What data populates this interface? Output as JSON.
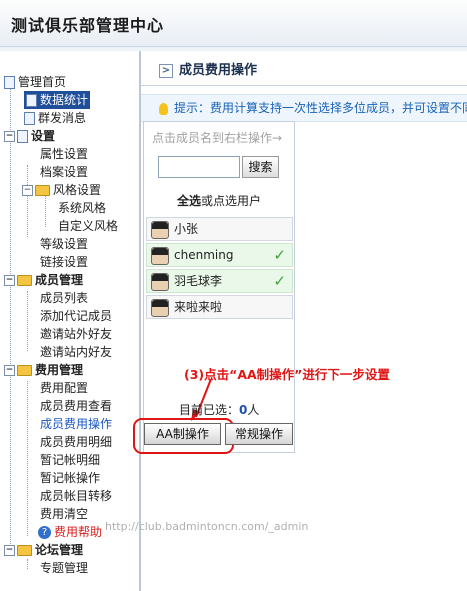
{
  "app": {
    "title": "测试俱乐部管理中心"
  },
  "sidebar": {
    "home": "管理首页",
    "stats": "数据统计",
    "messages": "群发消息",
    "settings": {
      "label": "设置",
      "items": {
        "attr": "属性设置",
        "profile": "档案设置",
        "style": "风格设置",
        "sys_style": "系统风格",
        "custom_style": "自定义风格",
        "level": "等级设置",
        "link": "链接设置"
      }
    },
    "members": {
      "label": "成员管理",
      "items": {
        "list": "成员列表",
        "add_proxy": "添加代记成员",
        "invite_out": "邀请站外好友",
        "invite_in": "邀请站内好友"
      }
    },
    "fees": {
      "label": "费用管理",
      "items": {
        "config": "费用配置",
        "view": "成员费用查看",
        "ops": "成员费用操作",
        "detail": "成员费用明细",
        "temp_detail": "暂记帐明细",
        "temp_ops": "暂记帐操作",
        "transfer": "成员帐目转移",
        "clear": "费用清空",
        "help": "费用帮助"
      }
    },
    "forum": {
      "label": "论坛管理",
      "items": {
        "topics": "专题管理"
      }
    }
  },
  "main": {
    "page_title": "成员费用操作",
    "tip": "提示：费用计算支持一次性选择多位成员，并可设置不同",
    "panel": {
      "hint": "点击成员名到右栏操作→",
      "search_button": "搜索",
      "select_all": "全选",
      "select_rest": "或点选用户",
      "members": [
        {
          "name": "小张",
          "selected": false
        },
        {
          "name": "chenming",
          "selected": true
        },
        {
          "name": "羽毛球李",
          "selected": true
        },
        {
          "name": "来啦来啦",
          "selected": false
        }
      ]
    },
    "annotation": "(3)点击“AA制操作”进行下一步设置",
    "count_label": "目前已选：",
    "count_value": "0",
    "count_unit": "人",
    "aa_button": "AA制操作",
    "normal_button": "常规操作"
  },
  "watermark": "http://club.badmintoncn.com/_admin",
  "colors": {
    "highlight": "#1f4f9a",
    "annotation": "#e01515",
    "tip_text": "#1a63b7",
    "check": "#3aa53a"
  }
}
